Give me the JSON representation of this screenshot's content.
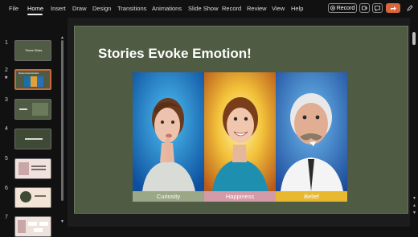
{
  "ribbon": {
    "tabs": [
      "File",
      "Home",
      "Insert",
      "Draw",
      "Design",
      "Transitions",
      "Animations",
      "Slide Show",
      "Record",
      "Review",
      "View",
      "Help"
    ],
    "active_tab": "Home",
    "record_label": "Record"
  },
  "sidebar": {
    "slides": [
      {
        "num": "1",
        "title": "Theme Slides"
      },
      {
        "num": "2",
        "title": "Stories Evoke Emotion"
      },
      {
        "num": "3",
        "title": ""
      },
      {
        "num": "4",
        "title": ""
      },
      {
        "num": "5",
        "title": ""
      },
      {
        "num": "6",
        "title": ""
      },
      {
        "num": "7",
        "title": ""
      }
    ],
    "selected": "2",
    "star": "★"
  },
  "slide": {
    "title": "Stories Evoke Emotion!",
    "captions": [
      "Curiosity",
      "Happiness",
      "Belief"
    ],
    "colors": {
      "background": "#4f5b42",
      "curiosity": "#9aa887",
      "happiness": "#d49aa8",
      "belief": "#e8b830"
    }
  }
}
